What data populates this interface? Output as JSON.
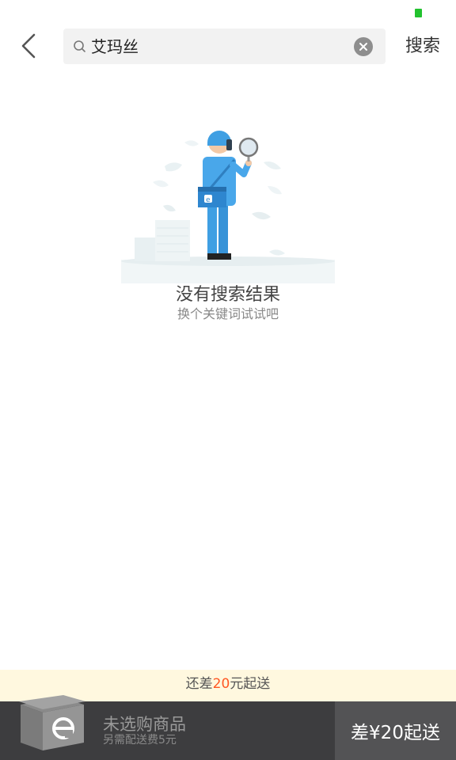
{
  "status": {
    "indicator_color": "#22c22e"
  },
  "header": {
    "back_icon": "chevron-left-icon",
    "search": {
      "value": "艾玛丝",
      "icon": "search-icon",
      "clear_icon": "clear-icon"
    },
    "submit_label": "搜索"
  },
  "empty_state": {
    "title": "没有搜索结果",
    "subtitle": "换个关键词试试吧"
  },
  "notice": {
    "prefix": "还差",
    "amount": "20",
    "suffix": "元起送",
    "accent_color": "#ff5722"
  },
  "cart": {
    "title": "未选购商品",
    "subtitle": "另需配送费5元",
    "checkout_label": "差¥20起送"
  }
}
